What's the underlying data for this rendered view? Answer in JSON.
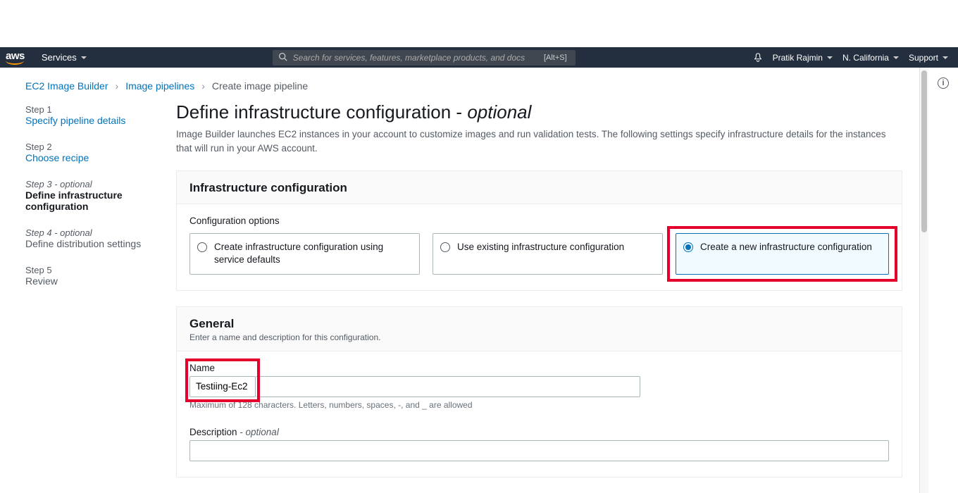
{
  "topnav": {
    "services_label": "Services",
    "search_placeholder": "Search for services, features, marketplace products, and docs",
    "search_kbd": "[Alt+S]",
    "user": "Pratik Rajmin",
    "region": "N. California",
    "support": "Support"
  },
  "breadcrumbs": {
    "items": [
      "EC2 Image Builder",
      "Image pipelines",
      "Create image pipeline"
    ]
  },
  "steps": [
    {
      "num": "Step 1",
      "label": "Specify pipeline details",
      "state": "link"
    },
    {
      "num": "Step 2",
      "label": "Choose recipe",
      "state": "link"
    },
    {
      "num": "Step 3 - optional",
      "label": "Define infrastructure configuration",
      "state": "active"
    },
    {
      "num": "Step 4 - optional",
      "label": "Define distribution settings",
      "state": "disabled"
    },
    {
      "num": "Step 5",
      "label": "Review",
      "state": "disabled"
    }
  ],
  "page": {
    "title_main": "Define infrastructure configuration - ",
    "title_suffix": "optional",
    "description": "Image Builder launches EC2 instances in your account to customize images and run validation tests. The following settings specify infrastructure details for the instances that will run in your AWS account."
  },
  "panel_infra": {
    "title": "Infrastructure configuration",
    "config_label": "Configuration options",
    "options": [
      "Create infrastructure configuration using service defaults",
      "Use existing infrastructure configuration",
      "Create a new infrastructure configuration"
    ]
  },
  "panel_general": {
    "title": "General",
    "subtitle": "Enter a name and description for this configuration.",
    "name_label": "Name",
    "name_value": "Testiing-Ec2",
    "name_help": "Maximum of 128 characters. Letters, numbers, spaces, -, and _ are allowed",
    "desc_label_main": "Description",
    "desc_label_suffix": " - optional"
  }
}
